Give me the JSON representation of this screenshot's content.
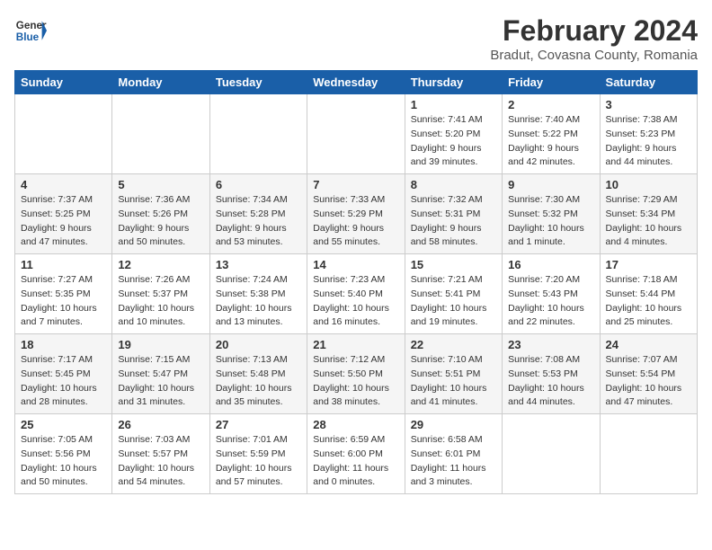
{
  "header": {
    "logo_general": "General",
    "logo_blue": "Blue",
    "title": "February 2024",
    "subtitle": "Bradut, Covasna County, Romania"
  },
  "columns": [
    "Sunday",
    "Monday",
    "Tuesday",
    "Wednesday",
    "Thursday",
    "Friday",
    "Saturday"
  ],
  "weeks": [
    [
      {
        "day": "",
        "sunrise": "",
        "sunset": "",
        "daylight": ""
      },
      {
        "day": "",
        "sunrise": "",
        "sunset": "",
        "daylight": ""
      },
      {
        "day": "",
        "sunrise": "",
        "sunset": "",
        "daylight": ""
      },
      {
        "day": "",
        "sunrise": "",
        "sunset": "",
        "daylight": ""
      },
      {
        "day": "1",
        "sunrise": "Sunrise: 7:41 AM",
        "sunset": "Sunset: 5:20 PM",
        "daylight": "Daylight: 9 hours and 39 minutes."
      },
      {
        "day": "2",
        "sunrise": "Sunrise: 7:40 AM",
        "sunset": "Sunset: 5:22 PM",
        "daylight": "Daylight: 9 hours and 42 minutes."
      },
      {
        "day": "3",
        "sunrise": "Sunrise: 7:38 AM",
        "sunset": "Sunset: 5:23 PM",
        "daylight": "Daylight: 9 hours and 44 minutes."
      }
    ],
    [
      {
        "day": "4",
        "sunrise": "Sunrise: 7:37 AM",
        "sunset": "Sunset: 5:25 PM",
        "daylight": "Daylight: 9 hours and 47 minutes."
      },
      {
        "day": "5",
        "sunrise": "Sunrise: 7:36 AM",
        "sunset": "Sunset: 5:26 PM",
        "daylight": "Daylight: 9 hours and 50 minutes."
      },
      {
        "day": "6",
        "sunrise": "Sunrise: 7:34 AM",
        "sunset": "Sunset: 5:28 PM",
        "daylight": "Daylight: 9 hours and 53 minutes."
      },
      {
        "day": "7",
        "sunrise": "Sunrise: 7:33 AM",
        "sunset": "Sunset: 5:29 PM",
        "daylight": "Daylight: 9 hours and 55 minutes."
      },
      {
        "day": "8",
        "sunrise": "Sunrise: 7:32 AM",
        "sunset": "Sunset: 5:31 PM",
        "daylight": "Daylight: 9 hours and 58 minutes."
      },
      {
        "day": "9",
        "sunrise": "Sunrise: 7:30 AM",
        "sunset": "Sunset: 5:32 PM",
        "daylight": "Daylight: 10 hours and 1 minute."
      },
      {
        "day": "10",
        "sunrise": "Sunrise: 7:29 AM",
        "sunset": "Sunset: 5:34 PM",
        "daylight": "Daylight: 10 hours and 4 minutes."
      }
    ],
    [
      {
        "day": "11",
        "sunrise": "Sunrise: 7:27 AM",
        "sunset": "Sunset: 5:35 PM",
        "daylight": "Daylight: 10 hours and 7 minutes."
      },
      {
        "day": "12",
        "sunrise": "Sunrise: 7:26 AM",
        "sunset": "Sunset: 5:37 PM",
        "daylight": "Daylight: 10 hours and 10 minutes."
      },
      {
        "day": "13",
        "sunrise": "Sunrise: 7:24 AM",
        "sunset": "Sunset: 5:38 PM",
        "daylight": "Daylight: 10 hours and 13 minutes."
      },
      {
        "day": "14",
        "sunrise": "Sunrise: 7:23 AM",
        "sunset": "Sunset: 5:40 PM",
        "daylight": "Daylight: 10 hours and 16 minutes."
      },
      {
        "day": "15",
        "sunrise": "Sunrise: 7:21 AM",
        "sunset": "Sunset: 5:41 PM",
        "daylight": "Daylight: 10 hours and 19 minutes."
      },
      {
        "day": "16",
        "sunrise": "Sunrise: 7:20 AM",
        "sunset": "Sunset: 5:43 PM",
        "daylight": "Daylight: 10 hours and 22 minutes."
      },
      {
        "day": "17",
        "sunrise": "Sunrise: 7:18 AM",
        "sunset": "Sunset: 5:44 PM",
        "daylight": "Daylight: 10 hours and 25 minutes."
      }
    ],
    [
      {
        "day": "18",
        "sunrise": "Sunrise: 7:17 AM",
        "sunset": "Sunset: 5:45 PM",
        "daylight": "Daylight: 10 hours and 28 minutes."
      },
      {
        "day": "19",
        "sunrise": "Sunrise: 7:15 AM",
        "sunset": "Sunset: 5:47 PM",
        "daylight": "Daylight: 10 hours and 31 minutes."
      },
      {
        "day": "20",
        "sunrise": "Sunrise: 7:13 AM",
        "sunset": "Sunset: 5:48 PM",
        "daylight": "Daylight: 10 hours and 35 minutes."
      },
      {
        "day": "21",
        "sunrise": "Sunrise: 7:12 AM",
        "sunset": "Sunset: 5:50 PM",
        "daylight": "Daylight: 10 hours and 38 minutes."
      },
      {
        "day": "22",
        "sunrise": "Sunrise: 7:10 AM",
        "sunset": "Sunset: 5:51 PM",
        "daylight": "Daylight: 10 hours and 41 minutes."
      },
      {
        "day": "23",
        "sunrise": "Sunrise: 7:08 AM",
        "sunset": "Sunset: 5:53 PM",
        "daylight": "Daylight: 10 hours and 44 minutes."
      },
      {
        "day": "24",
        "sunrise": "Sunrise: 7:07 AM",
        "sunset": "Sunset: 5:54 PM",
        "daylight": "Daylight: 10 hours and 47 minutes."
      }
    ],
    [
      {
        "day": "25",
        "sunrise": "Sunrise: 7:05 AM",
        "sunset": "Sunset: 5:56 PM",
        "daylight": "Daylight: 10 hours and 50 minutes."
      },
      {
        "day": "26",
        "sunrise": "Sunrise: 7:03 AM",
        "sunset": "Sunset: 5:57 PM",
        "daylight": "Daylight: 10 hours and 54 minutes."
      },
      {
        "day": "27",
        "sunrise": "Sunrise: 7:01 AM",
        "sunset": "Sunset: 5:59 PM",
        "daylight": "Daylight: 10 hours and 57 minutes."
      },
      {
        "day": "28",
        "sunrise": "Sunrise: 6:59 AM",
        "sunset": "Sunset: 6:00 PM",
        "daylight": "Daylight: 11 hours and 0 minutes."
      },
      {
        "day": "29",
        "sunrise": "Sunrise: 6:58 AM",
        "sunset": "Sunset: 6:01 PM",
        "daylight": "Daylight: 11 hours and 3 minutes."
      },
      {
        "day": "",
        "sunrise": "",
        "sunset": "",
        "daylight": ""
      },
      {
        "day": "",
        "sunrise": "",
        "sunset": "",
        "daylight": ""
      }
    ]
  ]
}
